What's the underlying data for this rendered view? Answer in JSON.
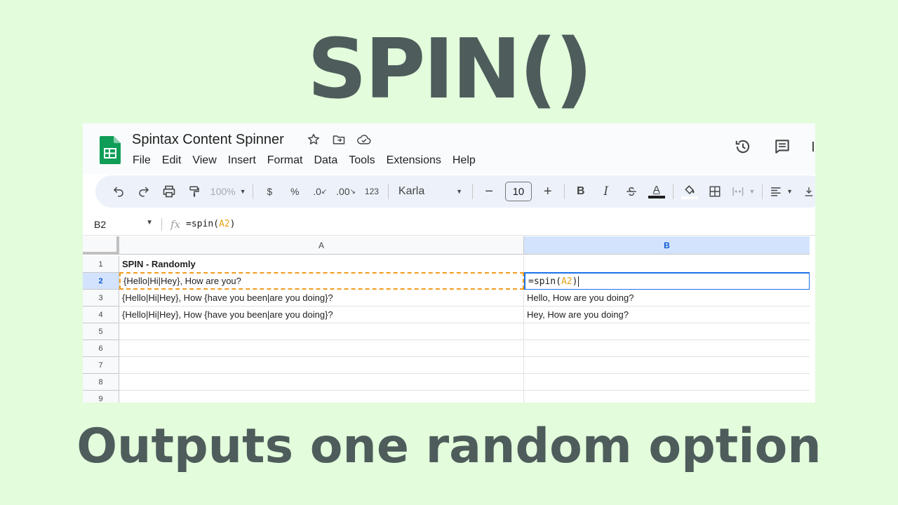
{
  "hero": {
    "title": "SPIN()",
    "subtitle": "Outputs one random option"
  },
  "app": {
    "doc_title": "Spintax Content Spinner",
    "menu": [
      "File",
      "Edit",
      "View",
      "Insert",
      "Format",
      "Data",
      "Tools",
      "Extensions",
      "Help"
    ],
    "title_icons": [
      "star-icon",
      "move-to-folder-icon",
      "cloud-saved-icon"
    ],
    "right_icons": [
      "version-history-icon",
      "comments-icon"
    ]
  },
  "toolbar": {
    "zoom": "100%",
    "currency": "$",
    "percent": "%",
    "decrease_decimal": ".0",
    "increase_decimal": ".00",
    "number_format": "123",
    "font": "Karla",
    "font_size": "10",
    "minus": "−",
    "plus": "+",
    "bold": "B",
    "italic": "I",
    "text_color_letter": "A"
  },
  "formula_bar": {
    "name_box": "B2",
    "fx": "fx",
    "formula_prefix": "=spin(",
    "formula_ref": "A2",
    "formula_suffix": ")"
  },
  "grid": {
    "columns": [
      "A",
      "B"
    ],
    "selected_column": "B",
    "row_numbers": [
      "1",
      "2",
      "3",
      "4",
      "5",
      "6",
      "7",
      "8",
      "9"
    ],
    "selected_row": "2",
    "rows": [
      {
        "a": "SPIN - Randomly",
        "b": ""
      },
      {
        "a": "{Hello|Hi|Hey}, How are you?",
        "b_prefix": "=spin(",
        "b_ref": "A2",
        "b_suffix": ")"
      },
      {
        "a": "{Hello|Hi|Hey}, How {have you been|are you doing}?",
        "b": "Hello, How are you doing?"
      },
      {
        "a": "{Hello|Hi|Hey}, How {have you been|are you doing}?",
        "b": "Hey, How are you doing?"
      }
    ]
  },
  "colors": {
    "background": "#e2fcdc",
    "headline": "#4e5c5b",
    "sheets_green": "#0f9d58",
    "selection_blue": "#1a73e8",
    "copy_orange": "#f29c1f",
    "ref_orange": "#e8a317"
  }
}
